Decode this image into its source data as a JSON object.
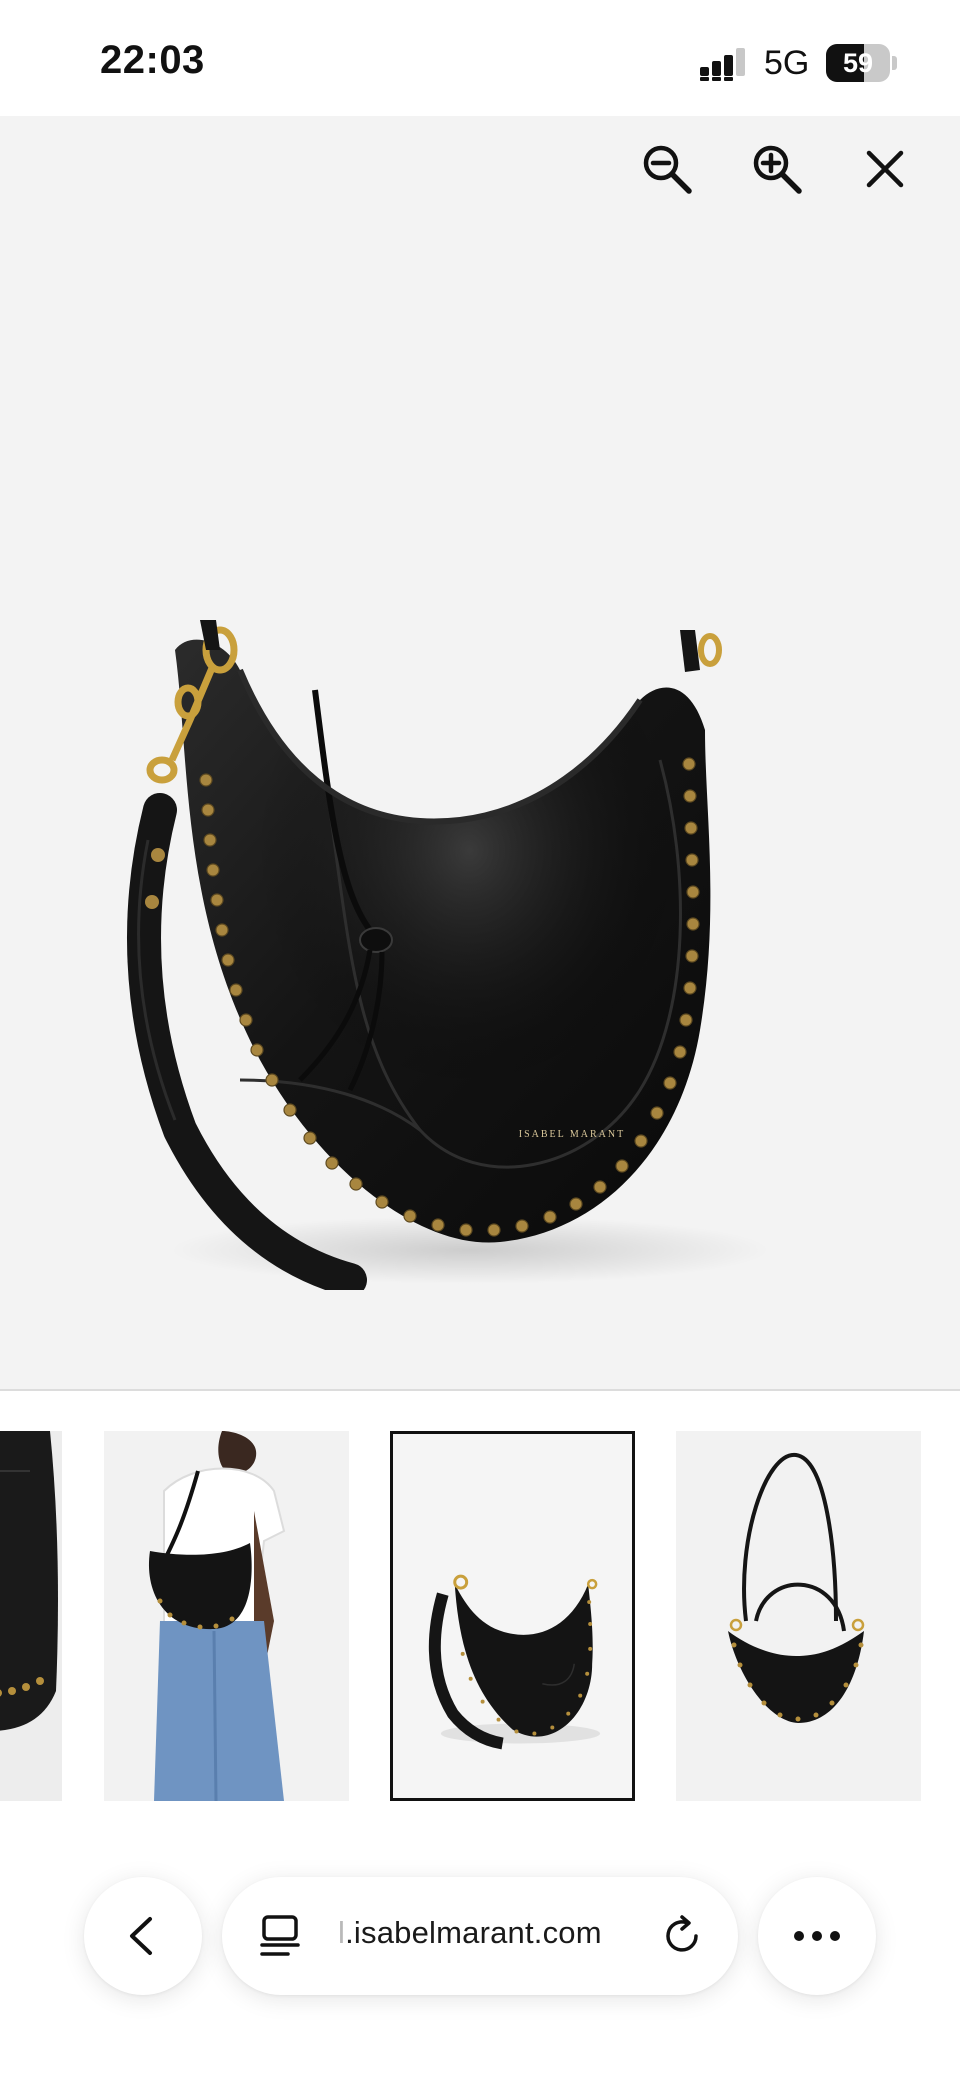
{
  "status_bar": {
    "time": "22:03",
    "network": "5G",
    "battery": "59",
    "battery_level": 0.59
  },
  "viewer": {
    "tools": [
      {
        "name": "zoom-out",
        "icon": "magnifier-minus-icon"
      },
      {
        "name": "zoom-in",
        "icon": "magnifier-plus-icon"
      },
      {
        "name": "close",
        "icon": "close-icon"
      }
    ],
    "image_logo_text": "ISABEL MARANT"
  },
  "thumbnails": {
    "count_visible": 4,
    "selected_index": 2
  },
  "browser": {
    "url_prefix": "l",
    "url_domain": ".isabelmarant.com",
    "icons": [
      "chevron-left-icon",
      "reader-icon",
      "reload-icon",
      "more-icon"
    ]
  },
  "colors": {
    "viewer_bg": "#f3f3f3",
    "leather": "#161616",
    "stud_gold": "#a8863f",
    "hardware_gold": "#c9a03c"
  }
}
